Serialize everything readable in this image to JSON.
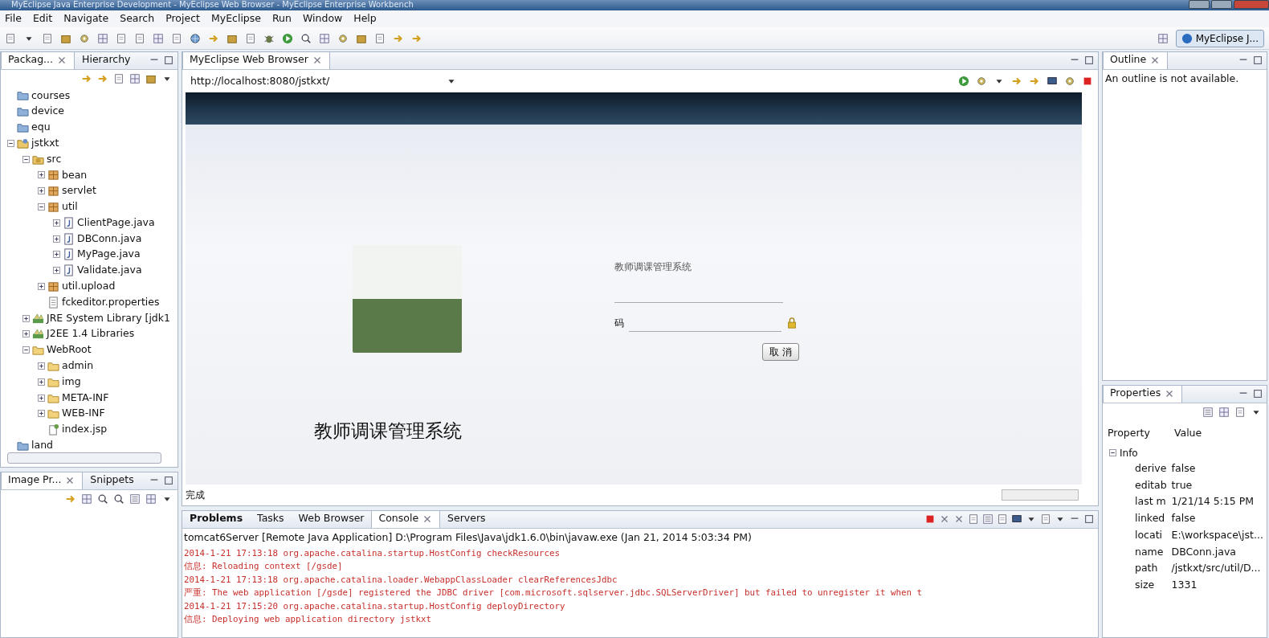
{
  "window": {
    "title": "MyEclipse Java Enterprise Development - MyEclipse Web Browser - MyEclipse Enterprise Workbench"
  },
  "menu": [
    "File",
    "Edit",
    "Navigate",
    "Search",
    "Project",
    "MyEclipse",
    "Run",
    "Window",
    "Help"
  ],
  "perspective": {
    "label": "MyEclipse J..."
  },
  "package_view": {
    "tabs": [
      {
        "label": "Packag...",
        "selected": true
      },
      {
        "label": "Hierarchy",
        "selected": false
      }
    ],
    "tree": [
      {
        "label": "courses",
        "kind": "folder"
      },
      {
        "label": "device",
        "kind": "folder"
      },
      {
        "label": "equ",
        "kind": "folder"
      },
      {
        "label": "jstkxt",
        "kind": "project",
        "expanded": true,
        "children": [
          {
            "label": "src",
            "kind": "source",
            "expanded": true,
            "children": [
              {
                "label": "bean",
                "kind": "package",
                "expanded": false
              },
              {
                "label": "servlet",
                "kind": "package",
                "expanded": false
              },
              {
                "label": "util",
                "kind": "package",
                "expanded": true,
                "children": [
                  {
                    "label": "ClientPage.java",
                    "kind": "java",
                    "expanded": false
                  },
                  {
                    "label": "DBConn.java",
                    "kind": "java",
                    "expanded": false
                  },
                  {
                    "label": "MyPage.java",
                    "kind": "java",
                    "expanded": false
                  },
                  {
                    "label": "Validate.java",
                    "kind": "java",
                    "expanded": false
                  }
                ]
              },
              {
                "label": "util.upload",
                "kind": "package",
                "expanded": false
              },
              {
                "label": "fckeditor.properties",
                "kind": "file"
              }
            ]
          },
          {
            "label": "JRE System Library [jdk1",
            "kind": "library",
            "expanded": false
          },
          {
            "label": "J2EE 1.4 Libraries",
            "kind": "library",
            "expanded": false
          },
          {
            "label": "WebRoot",
            "kind": "webfolder",
            "expanded": true,
            "children": [
              {
                "label": "admin",
                "kind": "webfolder",
                "expanded": false
              },
              {
                "label": "img",
                "kind": "webfolder",
                "expanded": false
              },
              {
                "label": "META-INF",
                "kind": "webfolder",
                "expanded": false
              },
              {
                "label": "WEB-INF",
                "kind": "webfolder",
                "expanded": false
              },
              {
                "label": "index.jsp",
                "kind": "jsp"
              }
            ]
          }
        ]
      },
      {
        "label": "land",
        "kind": "folder"
      }
    ]
  },
  "image_preview": {
    "tabs": [
      {
        "label": "Image Pr...",
        "selected": true
      },
      {
        "label": "Snippets",
        "selected": false
      }
    ]
  },
  "browser": {
    "tab": {
      "label": "MyEclipse Web Browser",
      "selected": true
    },
    "url": "http://localhost:8080/jstkxt/",
    "page": {
      "form_title": "教师调课管理系统",
      "password_label": "码",
      "cancel_button": "取 消",
      "system_title": "教师调课管理系统"
    },
    "status": "完成"
  },
  "console": {
    "tabs": [
      {
        "label": "Problems",
        "selected": false,
        "bold": true
      },
      {
        "label": "Tasks",
        "selected": false,
        "bold": false
      },
      {
        "label": "Web Browser",
        "selected": false,
        "bold": false
      },
      {
        "label": "Console",
        "selected": true,
        "bold": false
      },
      {
        "label": "Servers",
        "selected": false,
        "bold": false
      }
    ],
    "header": "tomcat6Server [Remote Java Application] D:\\Program Files\\Java\\jdk1.6.0\\bin\\javaw.exe (Jan 21, 2014 5:03:34 PM)",
    "lines": [
      "2014-1-21 17:13:18 org.apache.catalina.startup.HostConfig checkResources",
      "信息: Reloading context [/gsde]",
      "2014-1-21 17:13:18 org.apache.catalina.loader.WebappClassLoader clearReferencesJdbc",
      "严重: The web application [/gsde] registered the JDBC driver [com.microsoft.sqlserver.jdbc.SQLServerDriver] but failed to unregister it when t",
      "2014-1-21 17:15:20 org.apache.catalina.startup.HostConfig deployDirectory",
      "信息: Deploying web application directory jstkxt"
    ]
  },
  "outline": {
    "tab": {
      "label": "Outline",
      "selected": true
    },
    "message": "An outline is not available."
  },
  "properties": {
    "tab": {
      "label": "Properties",
      "selected": true
    },
    "columns": [
      "Property",
      "Value"
    ],
    "groups": [
      {
        "label": "Info",
        "expanded": true,
        "rows": [
          {
            "property": "derive",
            "value": "false"
          },
          {
            "property": "editab",
            "value": "true"
          },
          {
            "property": "last m",
            "value": "1/21/14 5:15 PM"
          },
          {
            "property": "linked",
            "value": "false"
          },
          {
            "property": "locati",
            "value": "E:\\workspace\\jst..."
          },
          {
            "property": "name",
            "value": "DBConn.java"
          },
          {
            "property": "path",
            "value": "/jstkxt/src/util/D..."
          },
          {
            "property": "size",
            "value": "1331"
          }
        ]
      }
    ]
  }
}
